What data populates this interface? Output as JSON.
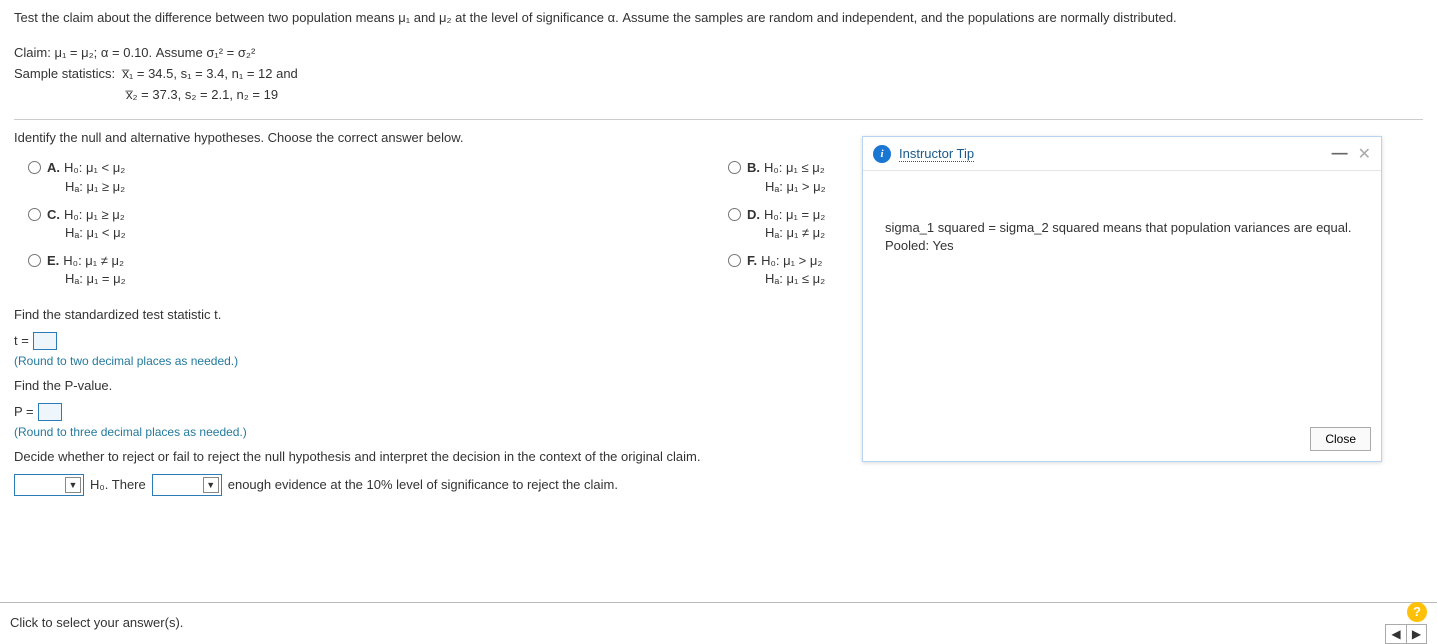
{
  "intro": "Test the claim about the difference between two population means μ₁ and μ₂ at the level of significance α. Assume the samples are random and independent, and the populations are normally distributed.",
  "claim_line": "Claim: μ₁ = μ₂; α = 0.10. Assume σ₁² = σ₂²",
  "stats_line1": "Sample statistics:  x̅₁ = 34.5, s₁ = 3.4, n₁ = 12 and",
  "stats_line2": "x̅₂ = 37.3, s₂ = 2.1, n₂ = 19",
  "identify_label": "Identify the null and alternative hypotheses. Choose the correct answer below.",
  "options": {
    "A": {
      "letter": "A.",
      "h0": "H₀: μ₁ < μ₂",
      "ha": "Hₐ: μ₁ ≥ μ₂"
    },
    "B": {
      "letter": "B.",
      "h0": "H₀: μ₁ ≤ μ₂",
      "ha": "Hₐ: μ₁ > μ₂"
    },
    "C": {
      "letter": "C.",
      "h0": "H₀: μ₁ ≥ μ₂",
      "ha": "Hₐ: μ₁ < μ₂"
    },
    "D": {
      "letter": "D.",
      "h0": "H₀: μ₁ = μ₂",
      "ha": "Hₐ: μ₁ ≠ μ₂"
    },
    "E": {
      "letter": "E.",
      "h0": "H₀: μ₁ ≠ μ₂",
      "ha": "Hₐ: μ₁ = μ₂"
    },
    "F": {
      "letter": "F.",
      "h0": "H₀: μ₁ > μ₂",
      "ha": "Hₐ: μ₁ ≤ μ₂"
    }
  },
  "find_t_label": "Find the standardized test statistic t.",
  "t_equals": "t =",
  "t_hint": "(Round to two decimal places as needed.)",
  "find_p_label": "Find the P-value.",
  "p_equals": "P =",
  "p_hint": "(Round to three decimal places as needed.)",
  "decide_label": "Decide whether to reject or fail to reject the null hypothesis and interpret the decision in the context of the original claim.",
  "conclusion": {
    "mid1": " H₀. There ",
    "mid2": " enough evidence at the 10% level of significance to reject the claim."
  },
  "footer_text": "Click to select your answer(s).",
  "tip": {
    "title": "Instructor Tip",
    "body": "sigma_1 squared = sigma_2 squared means that population variances are equal. Pooled: Yes",
    "close": "Close"
  }
}
